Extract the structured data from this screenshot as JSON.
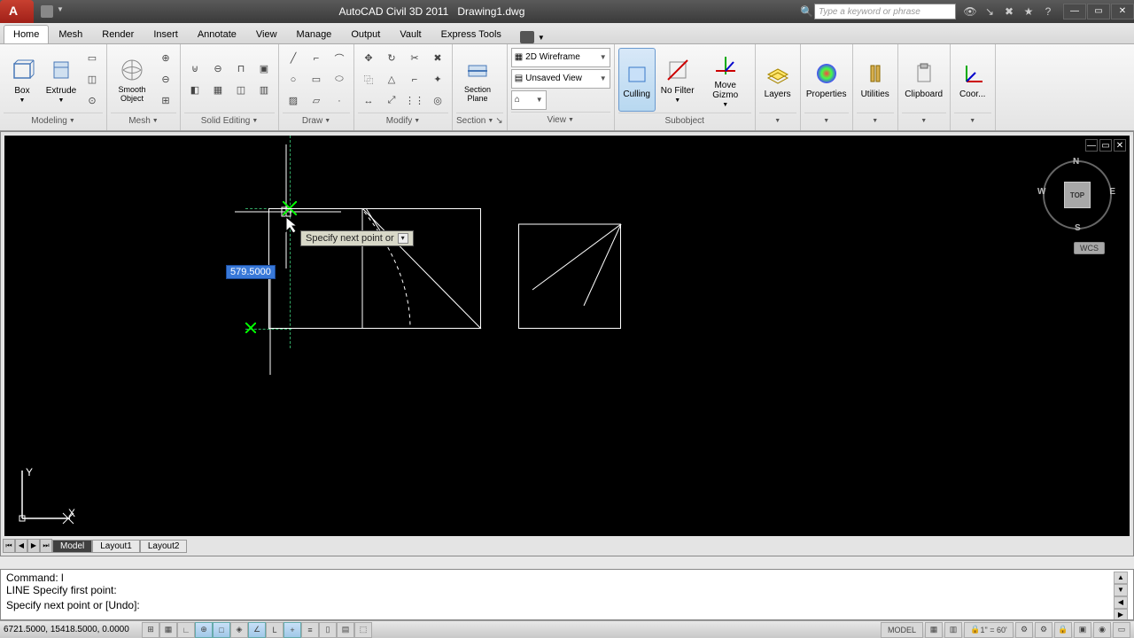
{
  "titlebar": {
    "app_name": "AutoCAD Civil 3D 2011",
    "doc_name": "Drawing1.dwg",
    "search_placeholder": "Type a keyword or phrase"
  },
  "tabs": {
    "items": [
      "Home",
      "Mesh",
      "Render",
      "Insert",
      "Annotate",
      "View",
      "Manage",
      "Output",
      "Vault",
      "Express Tools"
    ],
    "active": 0
  },
  "ribbon": {
    "modeling": {
      "title": "Modeling",
      "box": "Box",
      "extrude": "Extrude",
      "smooth": "Smooth Object"
    },
    "mesh_title": "Mesh",
    "solid_editing_title": "Solid Editing",
    "draw_title": "Draw",
    "modify_title": "Modify",
    "section": {
      "title": "Section",
      "section_plane": "Section Plane"
    },
    "view": {
      "title": "View",
      "visual_style": "2D Wireframe",
      "named_view": "Unsaved View"
    },
    "culling": "Culling",
    "no_filter": "No Filter",
    "move_gizmo": "Move Gizmo",
    "subobject_title": "Subobject",
    "layers": "Layers",
    "properties": "Properties",
    "utilities": "Utilities",
    "clipboard": "Clipboard",
    "coor": "Coor..."
  },
  "canvas": {
    "tooltip_text": "Specify next point or",
    "dynamic_input": "579.5000",
    "viewcube": {
      "face": "TOP",
      "n": "N",
      "s": "S",
      "e": "E",
      "w": "W"
    },
    "wcs": "WCS",
    "ucs_x": "X",
    "ucs_y": "Y"
  },
  "model_tabs": {
    "model": "Model",
    "layout1": "Layout1",
    "layout2": "Layout2"
  },
  "command": {
    "line1": "Command: l",
    "line2": "LINE Specify first point:",
    "line3": "Specify next point or [Undo]:"
  },
  "status": {
    "coords": "6721.5000, 15418.5000, 0.0000",
    "model_label": "MODEL",
    "scale": "1\" = 60'"
  }
}
